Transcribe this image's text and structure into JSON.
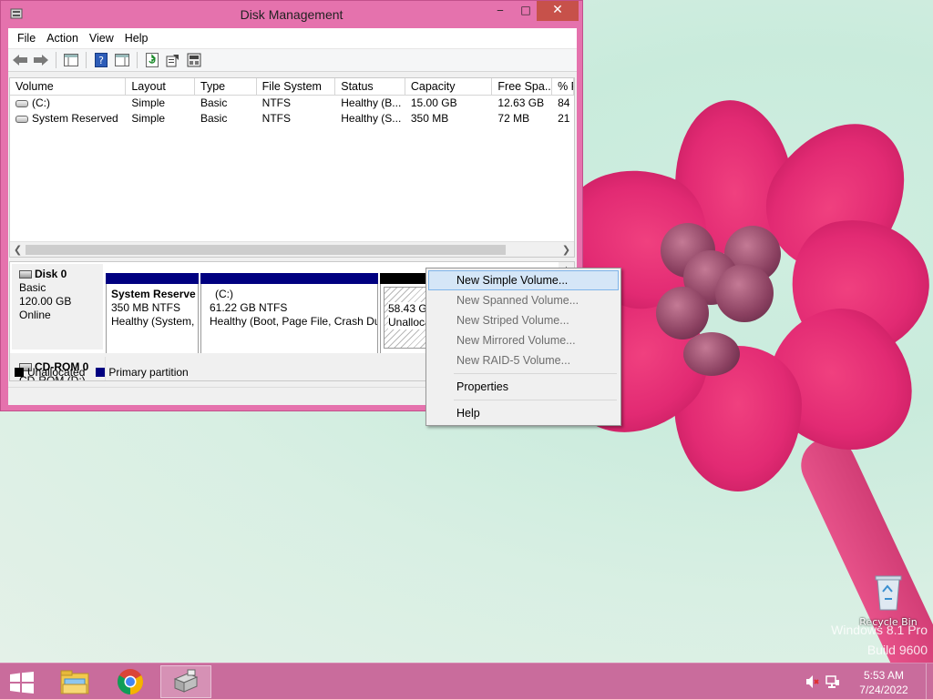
{
  "window": {
    "title": "Disk Management",
    "minimize": "‒",
    "maximize": "□",
    "close": "✕"
  },
  "menu": [
    "File",
    "Action",
    "View",
    "Help"
  ],
  "volume_list": {
    "columns": [
      "Volume",
      "Layout",
      "Type",
      "File System",
      "Status",
      "Capacity",
      "Free Spa...",
      "% F"
    ],
    "rows": [
      [
        "(C:)",
        "Simple",
        "Basic",
        "NTFS",
        "Healthy (B...",
        "15.00 GB",
        "12.63 GB",
        "84"
      ],
      [
        "System Reserved",
        "Simple",
        "Basic",
        "NTFS",
        "Healthy (S...",
        "350 MB",
        "72 MB",
        "21"
      ]
    ]
  },
  "disks": {
    "disk0": {
      "name": "Disk 0",
      "type": "Basic",
      "size": "120.00 GB",
      "state": "Online",
      "partitions": [
        {
          "name": "System Reserve",
          "size": "350 MB NTFS",
          "status": "Healthy (System,"
        },
        {
          "name": "(C:)",
          "size": "61.22 GB NTFS",
          "status": "Healthy (Boot, Page File, Crash Du"
        },
        {
          "name": "58.43 GB",
          "status": "Unalloca"
        }
      ]
    },
    "cdrom0": {
      "name": "CD-ROM 0",
      "label": "CD-ROM (D:)"
    }
  },
  "legend": {
    "unallocated": "Unallocated",
    "primary": "Primary partition",
    "unallocated_color": "#000000",
    "primary_color": "#000080"
  },
  "context_menu": {
    "items": [
      {
        "label": "New Simple Volume...",
        "enabled": true,
        "highlighted": true
      },
      {
        "label": "New Spanned Volume...",
        "enabled": false
      },
      {
        "label": "New Striped Volume...",
        "enabled": false
      },
      {
        "label": "New Mirrored Volume...",
        "enabled": false
      },
      {
        "label": "New RAID-5 Volume...",
        "enabled": false
      }
    ],
    "properties": "Properties",
    "help": "Help"
  },
  "desktop": {
    "recycle_bin": "Recycle Bin",
    "watermark_line1": "Windows 8.1 Pro",
    "watermark_line2": "Build 9600"
  },
  "taskbar": {
    "time": "5:53 AM",
    "date": "7/24/2022",
    "color": "#c96c9c"
  }
}
